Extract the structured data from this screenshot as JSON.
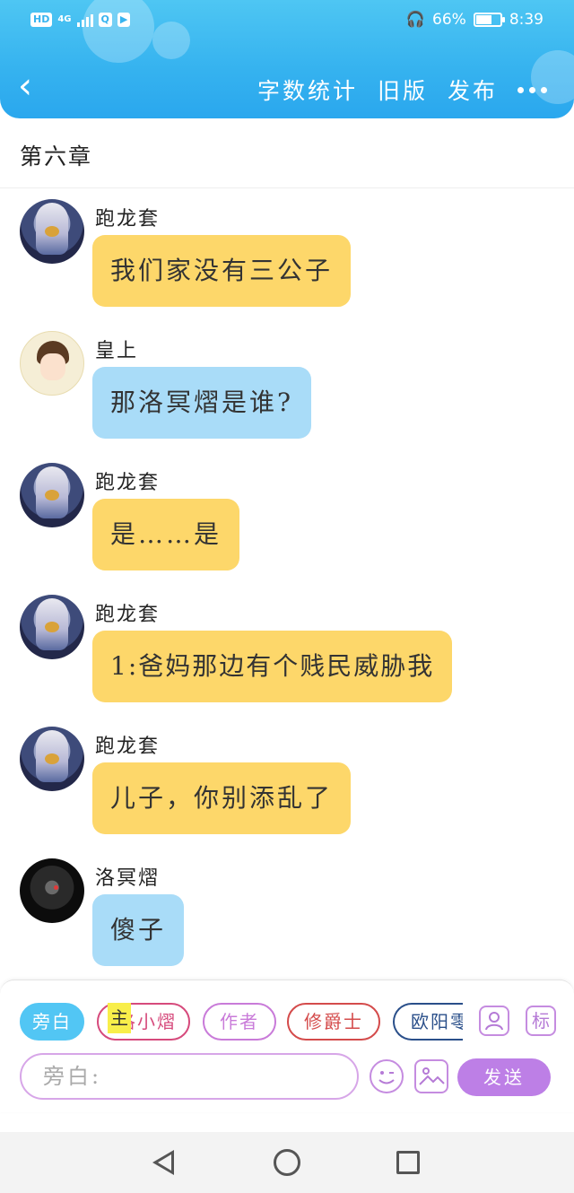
{
  "status_bar": {
    "hd_label": "HD",
    "network_label": "4G",
    "battery_text": "66%",
    "battery_level": 0.66,
    "time": "8:39"
  },
  "header": {
    "actions": [
      "字数统计",
      "旧版",
      "发布"
    ]
  },
  "chapter_title": "第六章",
  "messages": [
    {
      "sender": "跑龙套",
      "text": "我们家没有三公子",
      "color": "#fdd76a"
    },
    {
      "sender": "皇上",
      "text": "那洛冥熠是谁?",
      "color": "#a9dcf8"
    },
    {
      "sender": "跑龙套",
      "text": "是……是",
      "color": "#fdd76a"
    },
    {
      "sender": "跑龙套",
      "text": "1:爸妈那边有个贱民威胁我",
      "color": "#fdd76a"
    },
    {
      "sender": "跑龙套",
      "text": "儿子，你别添乱了",
      "color": "#fdd76a"
    },
    {
      "sender": "洛冥熠",
      "text": "傻子",
      "color": "#a9dcf8"
    }
  ],
  "input_panel": {
    "roles": [
      {
        "label": "旁白",
        "color": "#52c6f4",
        "active": true
      },
      {
        "label": "洛小熠",
        "color": "#d64a7c",
        "active": false
      },
      {
        "label": "作者",
        "color": "#c97bd9",
        "active": false
      },
      {
        "label": "修爵士",
        "color": "#d44b4b",
        "active": false
      },
      {
        "label": "欧阳零",
        "color": "#2a4f8a",
        "active": false
      }
    ],
    "main_tag": "主",
    "tag_button": "标",
    "input_placeholder": "旁白:",
    "send_label": "发送"
  },
  "colors": {
    "header": "#35b2ef",
    "yellow_bubble": "#fdd76a",
    "blue_bubble": "#a9dcf8",
    "accent_purple": "#bd7fe6"
  },
  "icons": [
    "back-chevron-icon",
    "more-dots-icon",
    "person-card-icon",
    "emoji-icon",
    "image-icon",
    "nav-back-icon",
    "nav-home-icon",
    "nav-recent-icon"
  ]
}
